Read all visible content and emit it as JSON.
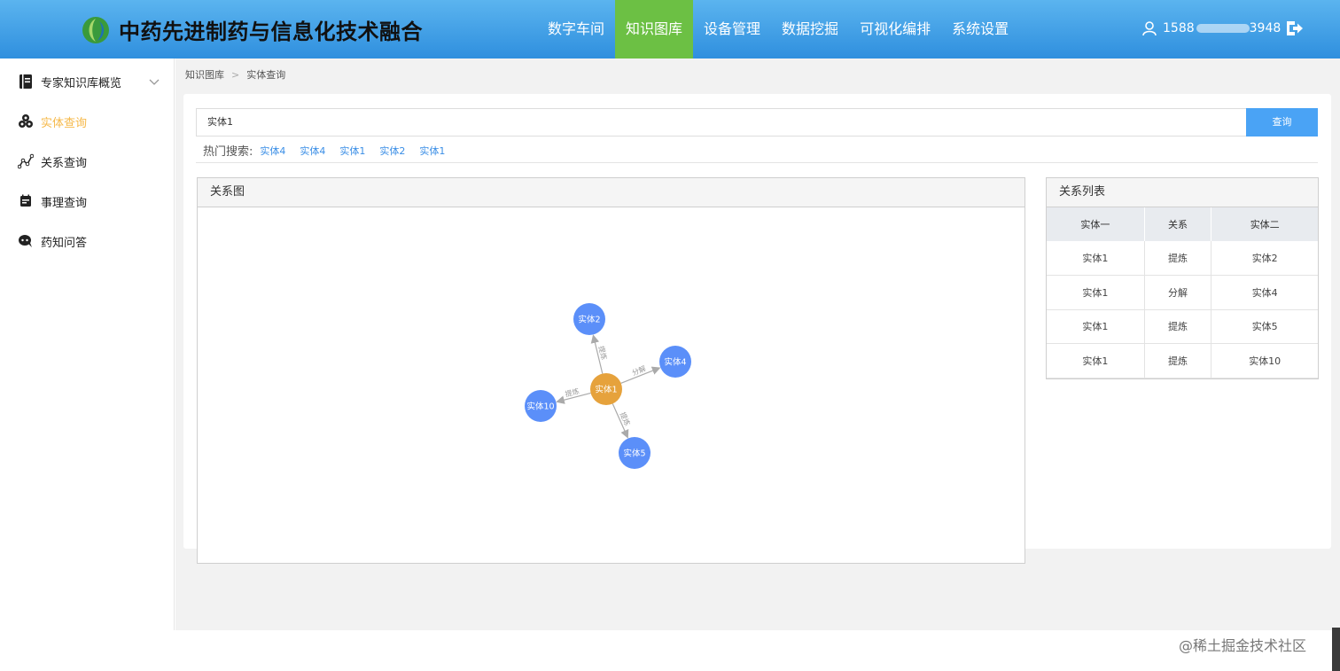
{
  "header": {
    "title": "中药先进制药与信息化技术融合",
    "nav": [
      "数字车间",
      "知识图库",
      "设备管理",
      "数据挖掘",
      "可视化编排",
      "系统设置"
    ],
    "active_nav": "知识图库",
    "user_phone_start": "1588",
    "user_phone_end": "3948",
    "user_icon": "user-icon",
    "logout_icon": "logout-icon"
  },
  "sidebar": {
    "items": [
      {
        "label": "专家知识库概览",
        "icon": "book-icon"
      },
      {
        "label": "实体查询",
        "icon": "cubes-icon"
      },
      {
        "label": "关系查询",
        "icon": "relation-line-icon"
      },
      {
        "label": "事理查询",
        "icon": "calendar-icon"
      },
      {
        "label": "药知问答",
        "icon": "chat-robot-icon"
      }
    ],
    "active": "实体查询"
  },
  "breadcrumb": [
    "知识图库",
    "实体查询"
  ],
  "search": {
    "value": "实体1",
    "button": "查询",
    "hot_label": "热门搜索:",
    "hot_links": [
      "实体4",
      "实体4",
      "实体1",
      "实体2",
      "实体1"
    ]
  },
  "graph": {
    "title": "关系图",
    "center": "实体1",
    "nodes": [
      "实体2",
      "实体4",
      "实体5",
      "实体10"
    ],
    "edges": [
      {
        "from": "实体1",
        "to": "实体2",
        "label": "提炼"
      },
      {
        "from": "实体1",
        "to": "实体4",
        "label": "分解"
      },
      {
        "from": "实体1",
        "to": "实体5",
        "label": "提炼"
      },
      {
        "from": "实体1",
        "to": "实体10",
        "label": "提炼"
      }
    ],
    "colors": {
      "center": "#e6a23c",
      "node": "#5b8ff9",
      "edge": "#aaaaaa"
    }
  },
  "relations": {
    "title": "关系列表",
    "columns": [
      "实体一",
      "关系",
      "实体二"
    ],
    "rows": [
      [
        "实体1",
        "提炼",
        "实体2"
      ],
      [
        "实体1",
        "分解",
        "实体4"
      ],
      [
        "实体1",
        "提炼",
        "实体5"
      ],
      [
        "实体1",
        "提炼",
        "实体10"
      ]
    ]
  },
  "watermark": "@稀土掘金技术社区"
}
